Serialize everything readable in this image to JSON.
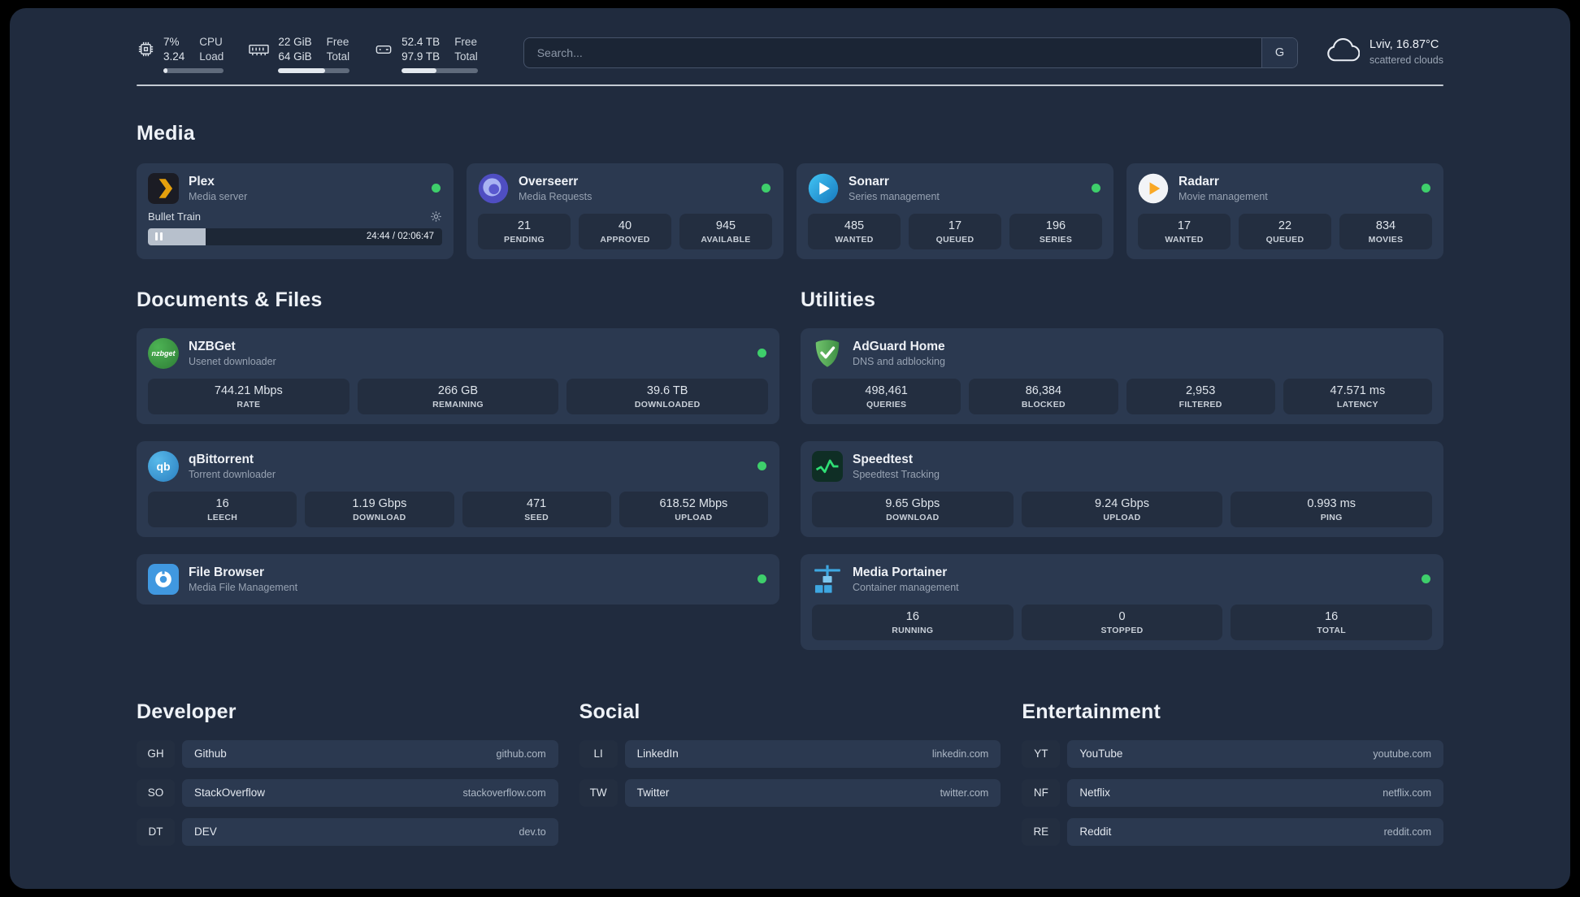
{
  "topbar": {
    "cpu": {
      "value_top": "7%",
      "value_bottom": "3.24",
      "label_top": "CPU",
      "label_bottom": "Load",
      "progress": 7
    },
    "ram": {
      "value_top": "22 GiB",
      "value_bottom": "64 GiB",
      "label_top": "Free",
      "label_bottom": "Total",
      "progress": 66
    },
    "disk": {
      "value_top": "52.4 TB",
      "value_bottom": "97.9 TB",
      "label_top": "Free",
      "label_bottom": "Total",
      "progress": 46
    },
    "search": {
      "placeholder": "Search...",
      "engine": "G"
    },
    "weather": {
      "location": "Lviv, 16.87°C",
      "condition": "scattered clouds"
    }
  },
  "sections": {
    "media": "Media",
    "documents": "Documents & Files",
    "utilities": "Utilities",
    "developer": "Developer",
    "social": "Social",
    "entertainment": "Entertainment"
  },
  "apps": {
    "plex": {
      "name": "Plex",
      "desc": "Media server",
      "now_playing": "Bullet Train",
      "time": "24:44 / 02:06:47",
      "progress": 19.5
    },
    "overseerr": {
      "name": "Overseerr",
      "desc": "Media Requests",
      "stats": [
        {
          "value": "21",
          "label": "PENDING"
        },
        {
          "value": "40",
          "label": "APPROVED"
        },
        {
          "value": "945",
          "label": "AVAILABLE"
        }
      ]
    },
    "sonarr": {
      "name": "Sonarr",
      "desc": "Series management",
      "stats": [
        {
          "value": "485",
          "label": "WANTED"
        },
        {
          "value": "17",
          "label": "QUEUED"
        },
        {
          "value": "196",
          "label": "SERIES"
        }
      ]
    },
    "radarr": {
      "name": "Radarr",
      "desc": "Movie management",
      "stats": [
        {
          "value": "17",
          "label": "WANTED"
        },
        {
          "value": "22",
          "label": "QUEUED"
        },
        {
          "value": "834",
          "label": "MOVIES"
        }
      ]
    },
    "nzbget": {
      "name": "NZBGet",
      "desc": "Usenet downloader",
      "icon_text": "nzbget",
      "stats": [
        {
          "value": "744.21 Mbps",
          "label": "RATE"
        },
        {
          "value": "266 GB",
          "label": "REMAINING"
        },
        {
          "value": "39.6 TB",
          "label": "DOWNLOADED"
        }
      ]
    },
    "qbittorrent": {
      "name": "qBittorrent",
      "desc": "Torrent downloader",
      "icon_text": "qb",
      "stats": [
        {
          "value": "16",
          "label": "LEECH"
        },
        {
          "value": "1.19 Gbps",
          "label": "DOWNLOAD"
        },
        {
          "value": "471",
          "label": "SEED"
        },
        {
          "value": "618.52 Mbps",
          "label": "UPLOAD"
        }
      ]
    },
    "filebrowser": {
      "name": "File Browser",
      "desc": "Media File Management"
    },
    "adguard": {
      "name": "AdGuard Home",
      "desc": "DNS and adblocking",
      "stats": [
        {
          "value": "498,461",
          "label": "QUERIES"
        },
        {
          "value": "86,384",
          "label": "BLOCKED"
        },
        {
          "value": "2,953",
          "label": "FILTERED"
        },
        {
          "value": "47.571 ms",
          "label": "LATENCY"
        }
      ]
    },
    "speedtest": {
      "name": "Speedtest",
      "desc": "Speedtest Tracking",
      "stats": [
        {
          "value": "9.65 Gbps",
          "label": "DOWNLOAD"
        },
        {
          "value": "9.24 Gbps",
          "label": "UPLOAD"
        },
        {
          "value": "0.993 ms",
          "label": "PING"
        }
      ]
    },
    "portainer": {
      "name": "Media Portainer",
      "desc": "Container management",
      "stats": [
        {
          "value": "16",
          "label": "RUNNING"
        },
        {
          "value": "0",
          "label": "STOPPED"
        },
        {
          "value": "16",
          "label": "TOTAL"
        }
      ]
    }
  },
  "bookmarks": {
    "developer": [
      {
        "abbr": "GH",
        "name": "Github",
        "url": "github.com"
      },
      {
        "abbr": "SO",
        "name": "StackOverflow",
        "url": "stackoverflow.com"
      },
      {
        "abbr": "DT",
        "name": "DEV",
        "url": "dev.to"
      }
    ],
    "social": [
      {
        "abbr": "LI",
        "name": "LinkedIn",
        "url": "linkedin.com"
      },
      {
        "abbr": "TW",
        "name": "Twitter",
        "url": "twitter.com"
      }
    ],
    "entertainment": [
      {
        "abbr": "YT",
        "name": "YouTube",
        "url": "youtube.com"
      },
      {
        "abbr": "NF",
        "name": "Netflix",
        "url": "netflix.com"
      },
      {
        "abbr": "RE",
        "name": "Reddit",
        "url": "reddit.com"
      }
    ]
  },
  "colors": {
    "status_online": "#3ecf6b"
  }
}
